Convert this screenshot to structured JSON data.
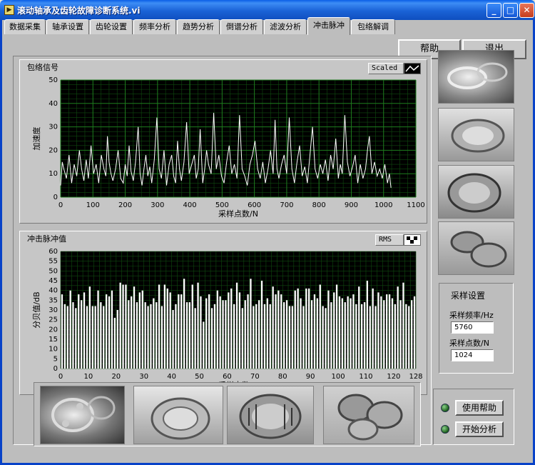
{
  "window": {
    "title": "滚动轴承及齿轮故障诊断系统.vi",
    "icon": "labview-vi-icon"
  },
  "tabs": [
    {
      "label": "数据采集"
    },
    {
      "label": "轴承设置"
    },
    {
      "label": "齿轮设置"
    },
    {
      "label": "频率分析"
    },
    {
      "label": "趋势分析"
    },
    {
      "label": "倒谱分析"
    },
    {
      "label": "滤波分析"
    },
    {
      "label": "冲击脉冲",
      "active": true
    },
    {
      "label": "包络解调"
    }
  ],
  "top_buttons": {
    "help": "帮助",
    "exit": "退出"
  },
  "envelope_chart": {
    "title": "包络信号",
    "scale_button": "Scaled"
  },
  "impulse_chart": {
    "title": "冲击脉冲值",
    "scale_button": "RMS"
  },
  "chart_data": [
    {
      "type": "line",
      "title": "包络信号",
      "xlabel": "采样点数/N",
      "ylabel": "加速度",
      "xlim": [
        0,
        1100
      ],
      "ylim": [
        0,
        50
      ],
      "xticks": [
        0,
        100,
        200,
        300,
        400,
        500,
        600,
        700,
        800,
        900,
        1000,
        1100
      ],
      "yticks": [
        0,
        10,
        20,
        30,
        40,
        50
      ],
      "grid": true,
      "background": "#000000",
      "line_color": "#ffffff",
      "grid_color": "#1e7a1e",
      "series": [
        {
          "x": [
            0,
            5,
            10,
            18,
            26,
            34,
            42,
            50,
            58,
            65,
            72,
            79,
            86,
            94,
            102,
            110,
            118,
            126,
            134,
            140,
            145,
            150,
            156,
            162,
            170,
            178,
            186,
            194,
            200,
            206,
            212,
            218,
            225,
            232,
            240,
            246,
            252,
            258,
            264,
            270,
            276,
            282,
            290,
            298,
            305,
            312,
            320,
            328,
            336,
            344,
            350,
            356,
            362,
            368,
            374,
            382,
            390,
            398,
            406,
            414,
            420,
            426,
            432,
            440,
            446,
            452,
            458,
            466,
            474,
            482,
            490,
            498,
            506,
            514,
            522,
            530,
            538,
            546,
            554,
            562,
            570,
            578,
            586,
            594,
            602,
            610,
            618,
            626,
            634,
            642,
            650,
            658,
            664,
            670,
            676,
            684,
            692,
            700,
            708,
            716,
            724,
            732,
            740,
            748,
            756,
            764,
            772,
            780,
            788,
            796,
            804,
            812,
            820,
            828,
            836,
            844,
            852,
            860,
            866,
            872,
            880,
            888,
            896,
            904,
            912,
            920,
            928,
            936,
            944,
            950,
            956,
            964,
            972,
            980,
            988,
            996,
            1004,
            1012,
            1018,
            1023
          ],
          "y": [
            5,
            15,
            12,
            8,
            18,
            6,
            14,
            9,
            20,
            12,
            7,
            16,
            8,
            22,
            10,
            14,
            6,
            18,
            12,
            9,
            26,
            15,
            10,
            7,
            12,
            20,
            8,
            6,
            14,
            9,
            22,
            11,
            7,
            15,
            30,
            10,
            5,
            12,
            18,
            9,
            13,
            6,
            16,
            34,
            12,
            8,
            20,
            5,
            14,
            18,
            9,
            6,
            24,
            12,
            7,
            15,
            32,
            10,
            14,
            18,
            8,
            12,
            29,
            6,
            12,
            20,
            14,
            10,
            36,
            12,
            18,
            9,
            6,
            15,
            22,
            10,
            14,
            8,
            35,
            12,
            9,
            5,
            14,
            18,
            24,
            12,
            8,
            15,
            6,
            12,
            20,
            10,
            33,
            12,
            8,
            14,
            18,
            10,
            34,
            12,
            6,
            15,
            22,
            9,
            13,
            6,
            18,
            30,
            12,
            8,
            14,
            10,
            16,
            7,
            18,
            12,
            25,
            8,
            14,
            10,
            35,
            15,
            9,
            13,
            18,
            6,
            14,
            8,
            12,
            20,
            26,
            10,
            15,
            9,
            12,
            8,
            14,
            6,
            10,
            4
          ]
        }
      ]
    },
    {
      "type": "bar",
      "title": "冲击脉冲值",
      "xlabel": "采样点数/N",
      "ylabel": "分贝值/dB",
      "xlim": [
        0,
        128
      ],
      "ylim": [
        0,
        60
      ],
      "xticks": [
        0,
        10,
        20,
        30,
        40,
        50,
        60,
        70,
        80,
        90,
        100,
        110,
        120,
        128
      ],
      "yticks": [
        0,
        5,
        10,
        15,
        20,
        25,
        30,
        35,
        40,
        45,
        50,
        55,
        60
      ],
      "grid": true,
      "background": "#000000",
      "bar_color": "#ffffff",
      "values": [
        38,
        33,
        32,
        40,
        34,
        31,
        38,
        35,
        39,
        32,
        42,
        32,
        32,
        40,
        34,
        32,
        38,
        37,
        40,
        26,
        30,
        44,
        43,
        43,
        35,
        37,
        42,
        34,
        39,
        40,
        34,
        32,
        33,
        36,
        34,
        43,
        32,
        43,
        41,
        39,
        30,
        33,
        38,
        38,
        46,
        34,
        34,
        43,
        31,
        44,
        37,
        24,
        36,
        38,
        31,
        33,
        40,
        37,
        35,
        35,
        39,
        41,
        33,
        44,
        39,
        31,
        35,
        38,
        46,
        32,
        33,
        35,
        45,
        33,
        36,
        33,
        42,
        38,
        40,
        38,
        34,
        35,
        32,
        32,
        40,
        41,
        36,
        32,
        41,
        41,
        35,
        38,
        36,
        43,
        32,
        31,
        40,
        34,
        39,
        43,
        37,
        36,
        34,
        37,
        36,
        38,
        33,
        42,
        33,
        34,
        45,
        32,
        41,
        32,
        39,
        37,
        35,
        38,
        38,
        36,
        33,
        42,
        35,
        44,
        33,
        32,
        35,
        37
      ]
    }
  ],
  "sample_settings": {
    "title": "采样设置",
    "freq_label": "采样频率/Hz",
    "freq_value": "5760",
    "points_label": "采样点数/N",
    "points_value": "1024"
  },
  "bottom_buttons": {
    "help": "使用帮助",
    "start": "开始分析"
  },
  "colors": {
    "plot_bg": "#000000",
    "grid": "#1e7a1e",
    "panel": "#bdbdbd",
    "led": "#1a5e1a",
    "titlebar": "#0a5ee6"
  }
}
